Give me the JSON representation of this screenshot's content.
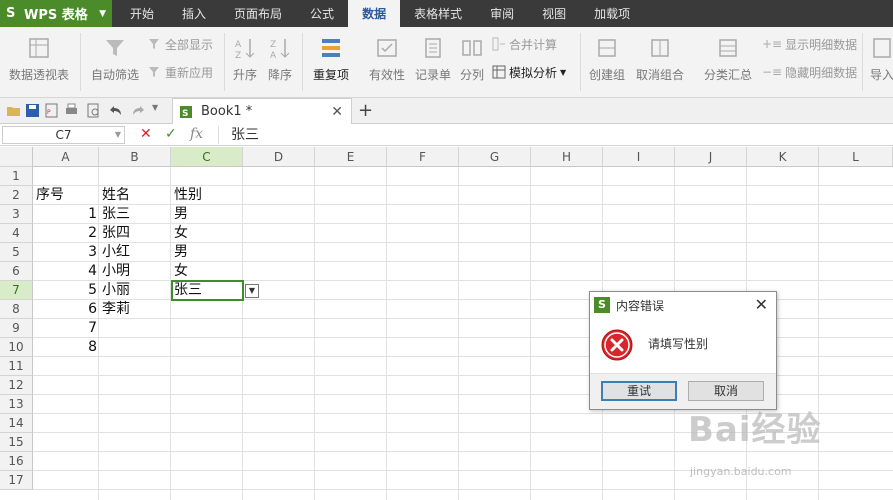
{
  "app": {
    "name": "WPS 表格"
  },
  "menu": [
    "开始",
    "插入",
    "页面布局",
    "公式",
    "数据",
    "表格样式",
    "审阅",
    "视图",
    "加载项"
  ],
  "active_menu": "数据",
  "ribbon": {
    "pivot": "数据透视表",
    "autofilter": "自动筛选",
    "show_all": "全部显示",
    "reapply": "重新应用",
    "sort_asc": "升序",
    "sort_desc": "降序",
    "duplicates": "重复项",
    "validity": "有效性",
    "record": "记录单",
    "split": "分列",
    "consolidate": "合并计算",
    "whatif": "模拟分析",
    "group": "创建组",
    "ungroup": "取消组合",
    "subtotal": "分类汇总",
    "show_detail": "显示明细数据",
    "hide_detail": "隐藏明细数据",
    "import": "导入"
  },
  "tab": {
    "title": "Book1 *"
  },
  "formula_bar": {
    "cell_ref": "C7",
    "content": "张三"
  },
  "columns": [
    "A",
    "B",
    "C",
    "D",
    "E",
    "F",
    "G",
    "H",
    "I",
    "J",
    "K",
    "L"
  ],
  "rows": [
    "1",
    "2",
    "3",
    "4",
    "5",
    "6",
    "7",
    "8",
    "9",
    "10",
    "11",
    "12",
    "13",
    "14",
    "15",
    "16",
    "17"
  ],
  "sheet": {
    "header": {
      "a": "序号",
      "b": "姓名",
      "c": "性别"
    },
    "data": [
      {
        "a": "1",
        "b": "张三",
        "c": "男"
      },
      {
        "a": "2",
        "b": "张四",
        "c": "女"
      },
      {
        "a": "3",
        "b": "小红",
        "c": "男"
      },
      {
        "a": "4",
        "b": "小明",
        "c": "女"
      },
      {
        "a": "5",
        "b": "小丽",
        "c": "张三"
      },
      {
        "a": "6",
        "b": "李莉",
        "c": ""
      },
      {
        "a": "7",
        "b": "",
        "c": ""
      },
      {
        "a": "8",
        "b": "",
        "c": ""
      }
    ]
  },
  "dialog": {
    "title": "内容错误",
    "message": "请填写性别",
    "retry": "重试",
    "cancel": "取消"
  },
  "watermark": {
    "main": "Bai经验",
    "sub": "jingyan.baidu.com"
  },
  "colors": {
    "accent": "#4b8b29",
    "selection": "#3c8f27",
    "error": "#d9262c",
    "menubar": "#3a3a3a"
  }
}
